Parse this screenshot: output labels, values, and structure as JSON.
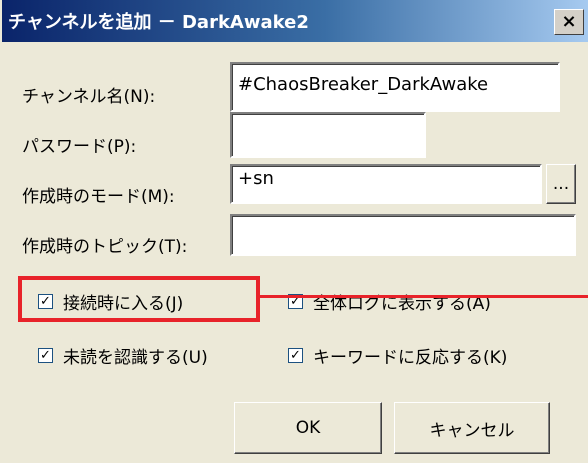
{
  "window": {
    "title": "チャンネルを追加 － DarkAwake2",
    "close_label": "×"
  },
  "form": {
    "channel_name": {
      "label": "チャンネル名(N):",
      "value": "#ChaosBreaker_DarkAwake"
    },
    "password": {
      "label": "パスワード(P):",
      "value": ""
    },
    "create_mode": {
      "label": "作成時のモード(M):",
      "value": "+sn",
      "browse_label": "..."
    },
    "create_topic": {
      "label": "作成時のトピック(T):",
      "value": ""
    }
  },
  "options": [
    {
      "label": "接続時に入る(J)",
      "checked": true
    },
    {
      "label": "全体ログに表示する(A)",
      "checked": true
    },
    {
      "label": "未読を認識する(U)",
      "checked": true
    },
    {
      "label": "キーワードに反応する(K)",
      "checked": true
    }
  ],
  "buttons": {
    "ok": "OK",
    "cancel": "キャンセル"
  },
  "checkmark": "☑"
}
